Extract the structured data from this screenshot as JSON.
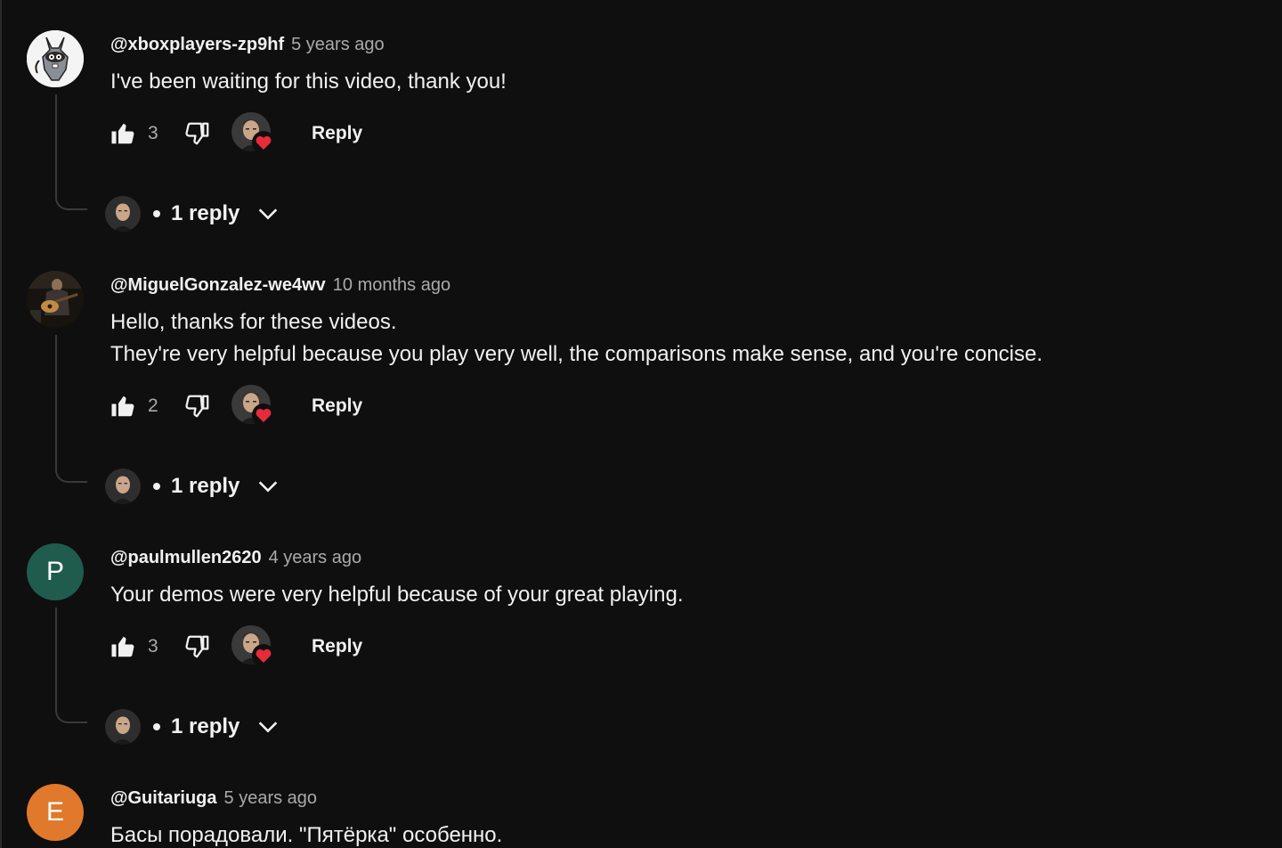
{
  "comments": [
    {
      "author": "@xboxplayers-zp9hf",
      "time": "5 years ago",
      "text": [
        "I've been waiting for this video, thank you!"
      ],
      "likes": "3",
      "reply_label": "Reply",
      "replies_label": "1 reply",
      "avatar_icon": "raccoon-cartoon-icon"
    },
    {
      "author": "@MiguelGonzalez-we4wv",
      "time": "10 months ago",
      "text": [
        "Hello, thanks for these videos.",
        "They're very helpful because you play very well, the comparisons make sense, and you're concise."
      ],
      "likes": "2",
      "reply_label": "Reply",
      "replies_label": "1 reply",
      "avatar_icon": "guitar-player-photo"
    },
    {
      "author": "@paulmullen2620",
      "time": "4 years ago",
      "text": [
        "Your demos were very helpful because of your great playing."
      ],
      "likes": "3",
      "reply_label": "Reply",
      "replies_label": "1 reply",
      "avatar_letter": "P",
      "avatar_color": "#1f5c4e"
    },
    {
      "author": "@Guitariuga",
      "time": "5 years ago",
      "text": [
        "Басы порадовали. \"Пятёрка\" особенно."
      ],
      "avatar_letter": "E",
      "avatar_color": "#e0792b"
    }
  ],
  "colors": {
    "background": "#0f0f0f",
    "heart": "#e62b3b",
    "muted": "#aaaaaa"
  }
}
